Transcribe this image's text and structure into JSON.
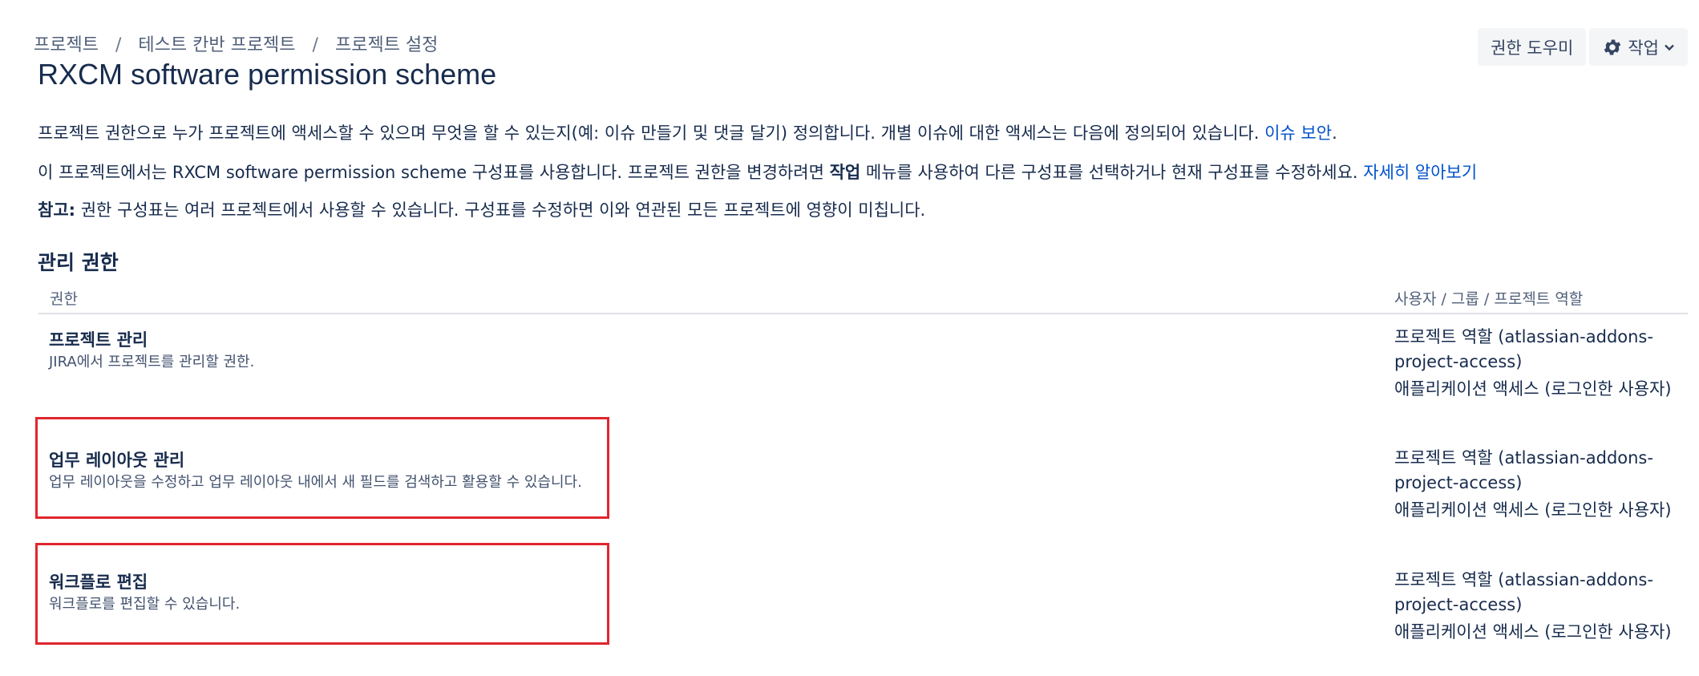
{
  "breadcrumb": {
    "items": [
      "프로젝트",
      "테스트 칸반 프로젝트",
      "프로젝트 설정"
    ],
    "separator": "/"
  },
  "page": {
    "title": "RXCM software permission scheme"
  },
  "toolbar": {
    "help_label": "권한 도우미",
    "actions_label": "작업",
    "actions_icon": "gear-icon",
    "dropdown_icon": "chevron-down-icon"
  },
  "intro": {
    "line1_text": "프로젝트 권한으로 누가 프로젝트에 액세스할 수 있으며 무엇을 할 수 있는지(예: 이슈 만들기 및 댓글 달기) 정의합니다. 개별 이슈에 대한 액세스는 다음에 정의되어 있습니다. ",
    "line1_link": "이슈 보안",
    "line1_end": ".",
    "line2_pre": "이 프로젝트에서는 RXCM software permission scheme 구성표를 사용합니다. 프로젝트 권한을 변경하려면 ",
    "line2_bold": "작업",
    "line2_post": " 메뉴를 사용하여 다른 구성표를 선택하거나 현재 구성표를 수정하세요. ",
    "line2_link": "자세히 알아보기",
    "note_label": "참고:",
    "note_text": " 권한 구성표는 여러 프로젝트에서 사용할 수 있습니다. 구성표를 수정하면 이와 연관된 모든 프로젝트에 영향이 미칩니다."
  },
  "section": {
    "title": "관리 권한",
    "col_permission": "권한",
    "col_grants": "사용자 / 그룹 / 프로젝트 역할"
  },
  "permissions": [
    {
      "name": "프로젝트 관리",
      "desc": "JIRA에서 프로젝트를 관리할 권한.",
      "grant1": "프로젝트 역할 (atlassian-addons-project-access)",
      "grant2": "애플리케이션 액세스 (로그인한 사용자)"
    },
    {
      "name": "업무 레이아웃 관리",
      "desc": "업무 레이아웃을 수정하고 업무 레이아웃 내에서 새 필드를 검색하고 활용할 수 있습니다.",
      "grant1": "프로젝트 역할 (atlassian-addons-project-access)",
      "grant2": "애플리케이션 액세스 (로그인한 사용자)"
    },
    {
      "name": "워크플로 편집",
      "desc": "워크플로를 편집할 수 있습니다.",
      "grant1": "프로젝트 역할 (atlassian-addons-project-access)",
      "grant2": "애플리케이션 액세스 (로그인한 사용자)"
    }
  ],
  "colors": {
    "link": "#0052cc",
    "highlight": "#e0262e",
    "text": "#172b4d"
  }
}
